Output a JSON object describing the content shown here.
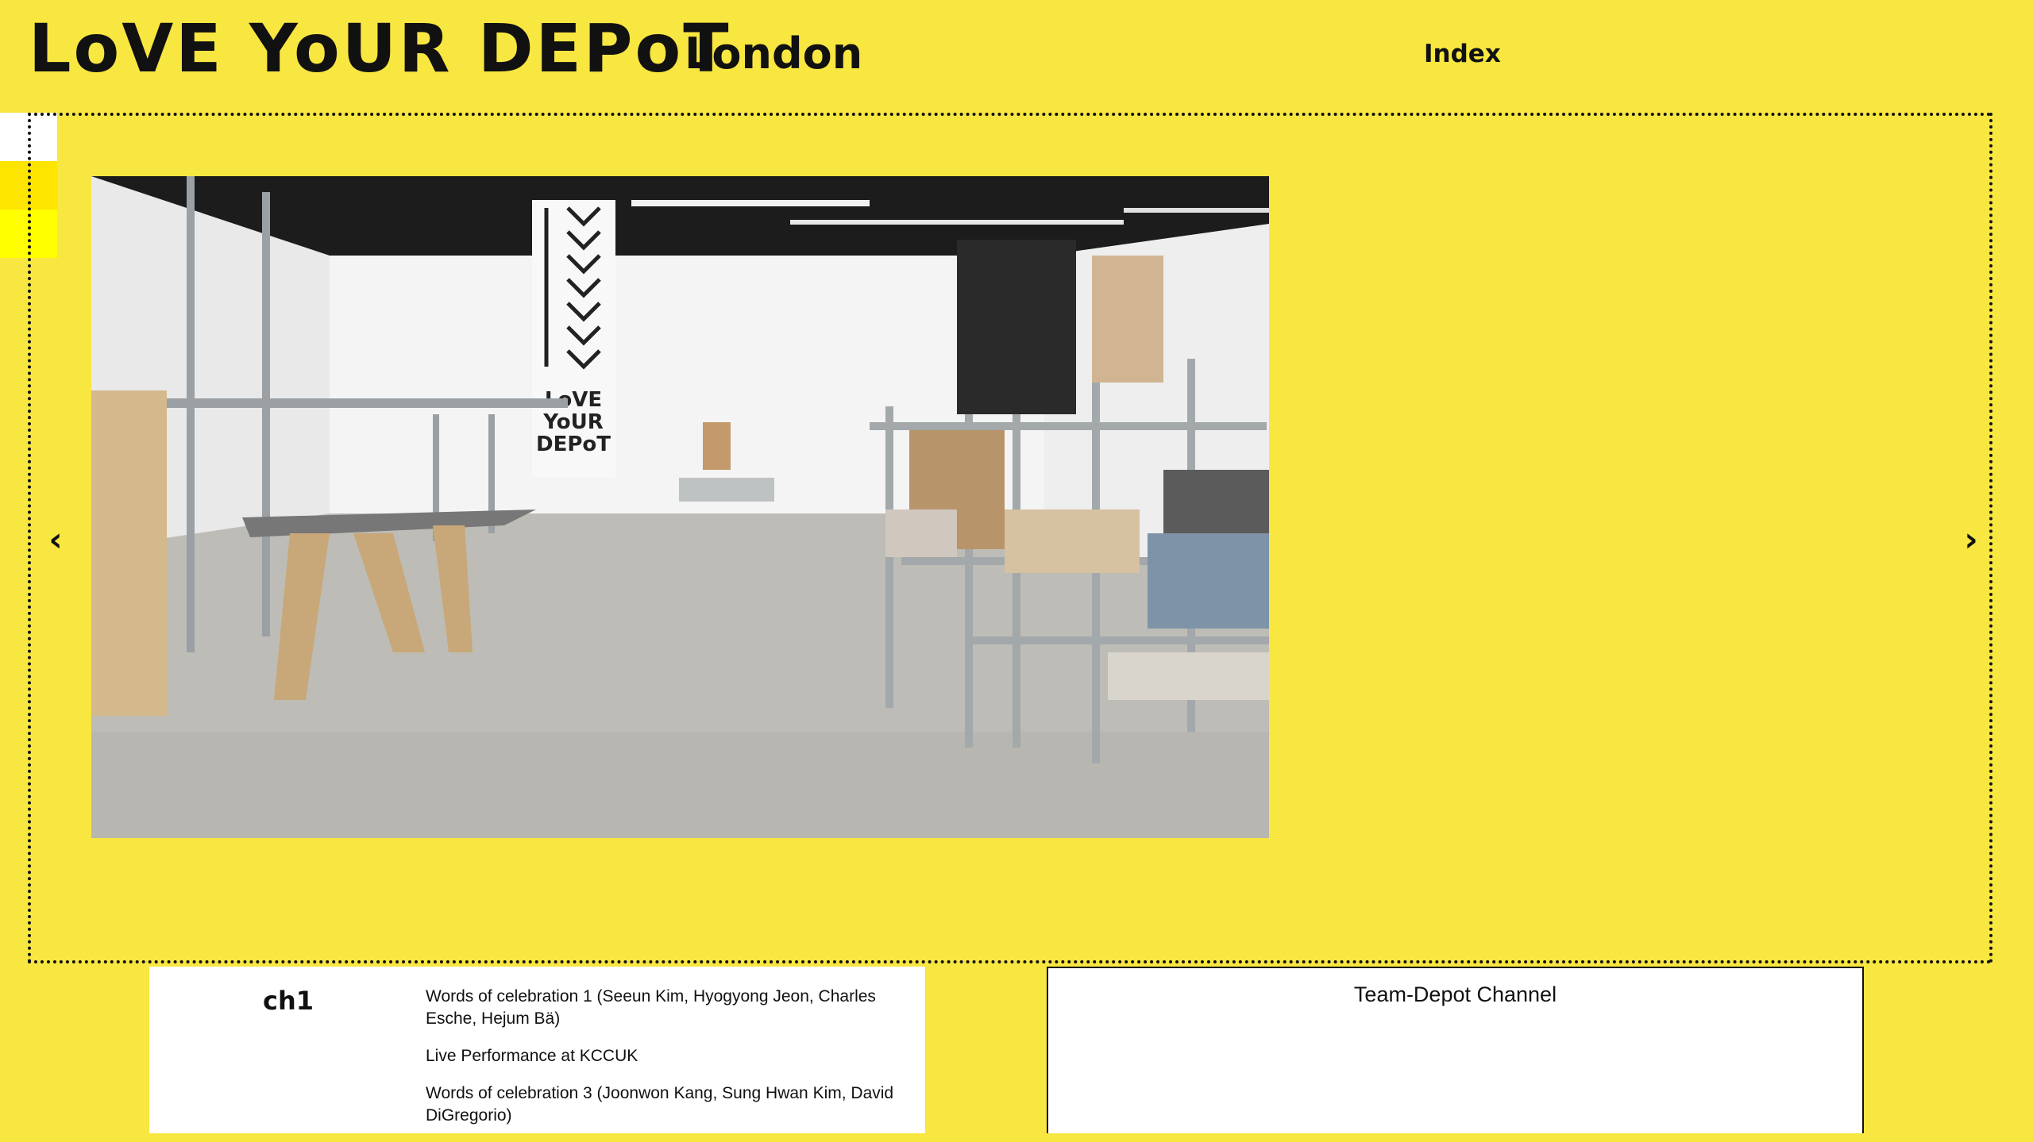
{
  "header": {
    "logo": "LoVE YoUR DEPoT",
    "location": "London",
    "nav_index": "Index"
  },
  "swatches": [
    "#ffffff",
    "#fee500",
    "#ffff00"
  ],
  "carousel": {
    "prev_label": "‹",
    "next_label": "›",
    "photo_sign": [
      "LoVE",
      "YoUR",
      "DEPoT"
    ]
  },
  "chapters": {
    "label": "ch1",
    "items": [
      "Words of celebration 1 (Seeun Kim, Hyogyong Jeon, Charles Esche, Hejum Bä)",
      "Live Performance at KCCUK",
      "Words of celebration 3 (Joonwon Kang, Sung Hwan Kim, David DiGregorio)"
    ]
  },
  "channel": {
    "title": "Team-Depot Channel"
  },
  "colors": {
    "background": "#f8e641",
    "text": "#111111",
    "panel": "#ffffff"
  }
}
